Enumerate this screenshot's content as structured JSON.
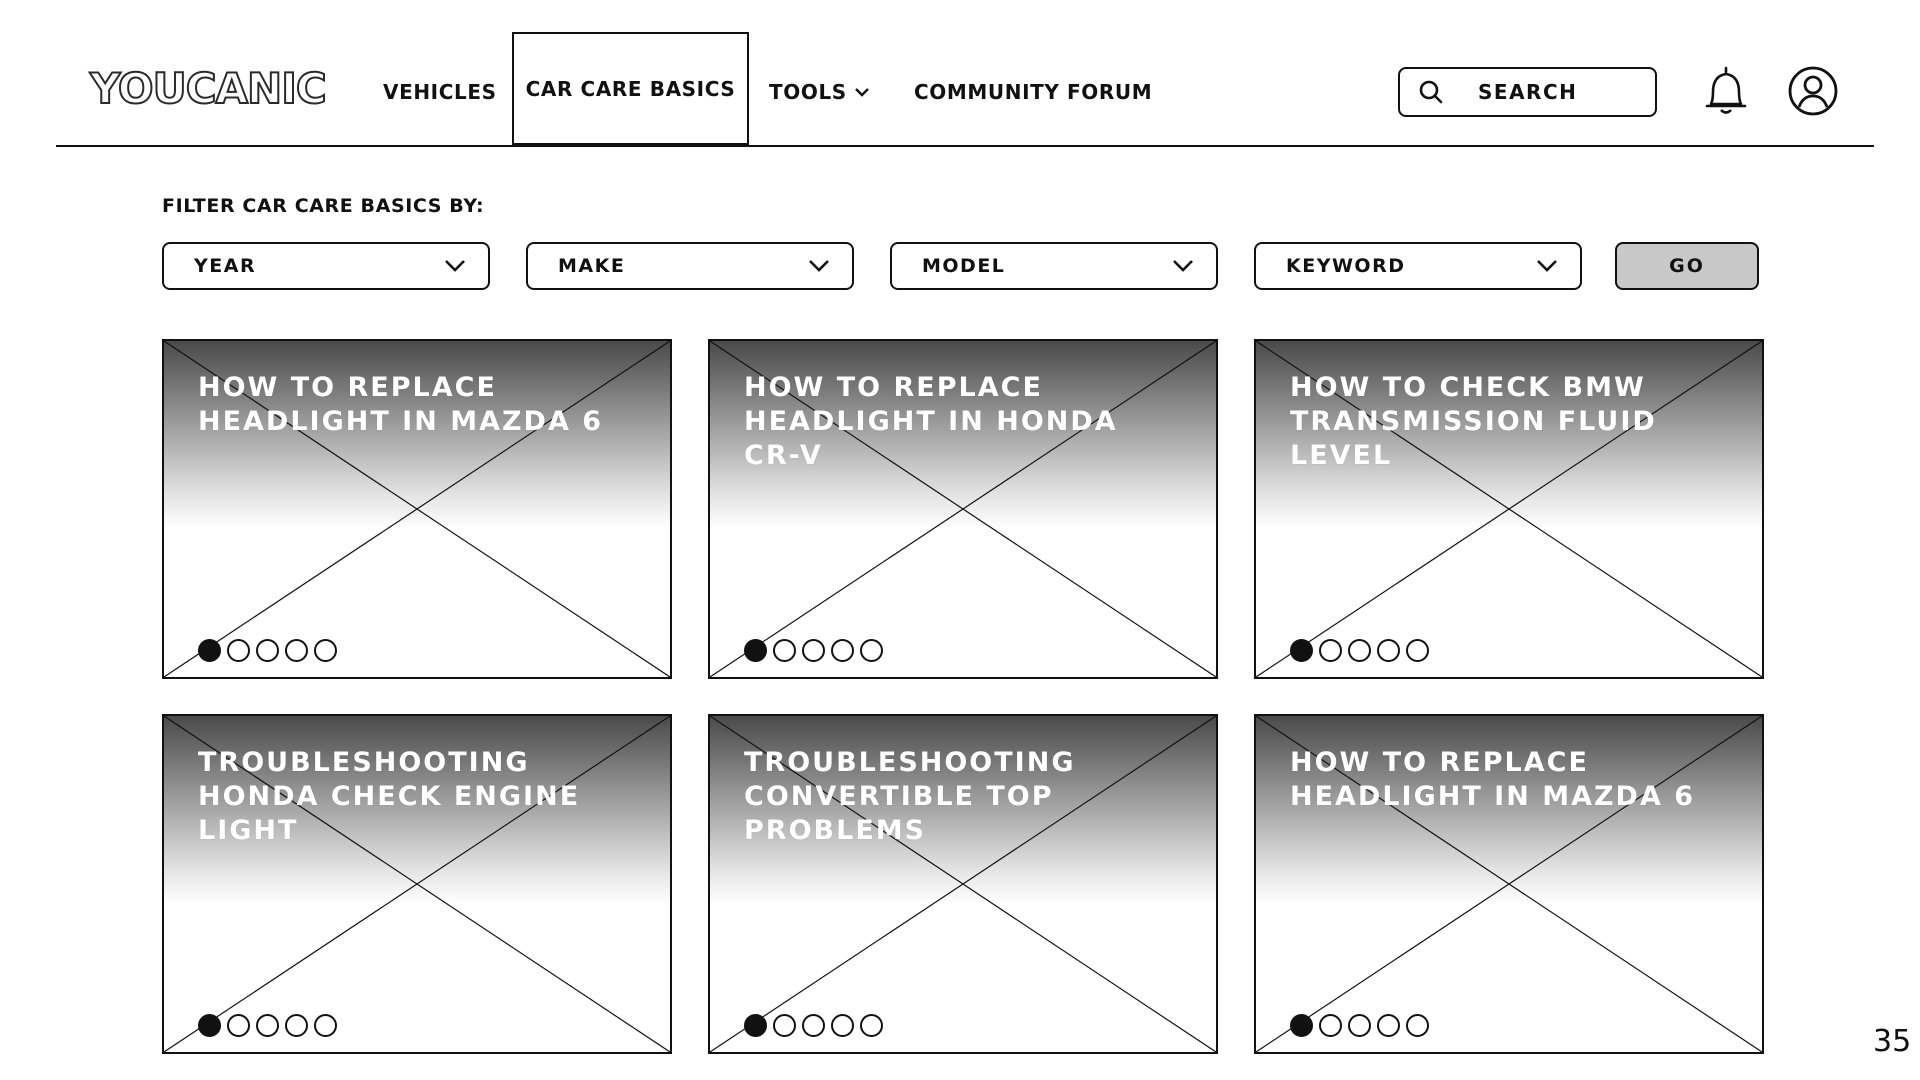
{
  "header": {
    "logo": "YOUCANIC",
    "nav": {
      "vehicles": "VEHICLES",
      "car_care_basics": "CAR CARE BASICS",
      "tools": "TOOLS",
      "community_forum": "COMMUNITY FORUM"
    },
    "search_label": "SEARCH",
    "icons": {
      "search": "search-icon",
      "notifications": "bell-icon",
      "account": "user-icon",
      "dropdown": "chevron-down-icon"
    }
  },
  "filter": {
    "title": "FILTER CAR CARE BASICS BY:",
    "selects": {
      "year": "YEAR",
      "make": "MAKE",
      "model": "MODEL",
      "keyword": "KEYWORD"
    },
    "go_label": "GO"
  },
  "cards": [
    {
      "title": "HOW TO REPLACE HEADLIGHT IN MAZDA 6",
      "slides": 5,
      "active_slide": 1
    },
    {
      "title": "HOW TO REPLACE HEADLIGHT IN HONDA CR-V",
      "slides": 5,
      "active_slide": 1
    },
    {
      "title": "HOW TO CHECK BMW TRANSMISSION FLUID LEVEL",
      "slides": 5,
      "active_slide": 1
    },
    {
      "title": "TROUBLESHOOTING HONDA CHECK ENGINE LIGHT",
      "slides": 5,
      "active_slide": 1
    },
    {
      "title": "TROUBLESHOOTING CONVERTIBLE TOP PROBLEMS",
      "slides": 5,
      "active_slide": 1
    },
    {
      "title": "HOW TO REPLACE HEADLIGHT IN MAZDA 6",
      "slides": 5,
      "active_slide": 1
    }
  ],
  "page_number": "35"
}
